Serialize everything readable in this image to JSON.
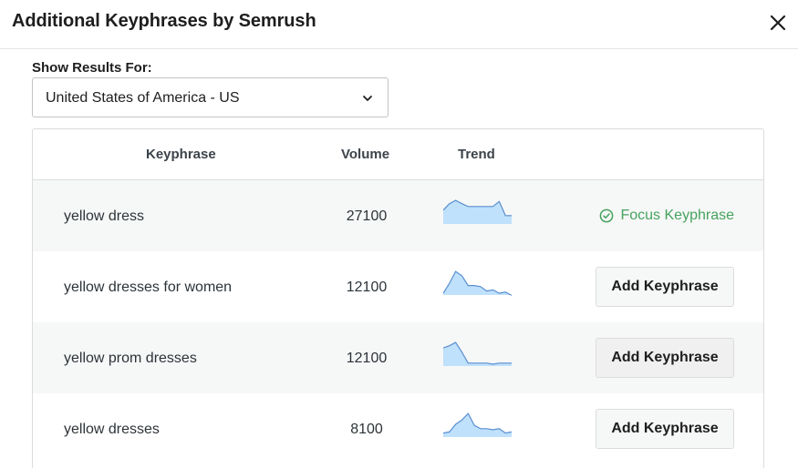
{
  "modal": {
    "title": "Additional Keyphrases by Semrush"
  },
  "filter": {
    "label": "Show Results For:",
    "selected": "United States of America - US"
  },
  "table": {
    "headers": {
      "keyphrase": "Keyphrase",
      "volume": "Volume",
      "trend": "Trend"
    },
    "rows": [
      {
        "keyphrase": "yellow dress",
        "volume": "27100",
        "trend": [
          0.55,
          0.85,
          1.0,
          0.85,
          0.72,
          0.72,
          0.72,
          0.72,
          0.72,
          0.95,
          0.3,
          0.3
        ],
        "status": "Focus Keyphrase"
      },
      {
        "keyphrase": "yellow dresses for women",
        "volume": "12100",
        "trend": [
          0.0,
          0.45,
          1.0,
          0.8,
          0.35,
          0.35,
          0.3,
          0.1,
          0.15,
          0.0,
          0.05,
          -0.1
        ],
        "action": "Add Keyphrase"
      },
      {
        "keyphrase": "yellow prom dresses",
        "volume": "12100",
        "trend": [
          0.75,
          0.85,
          1.0,
          0.55,
          0.05,
          0.05,
          0.05,
          0.05,
          0.0,
          0.05,
          0.05,
          0.05
        ],
        "action": "Add Keyphrase"
      },
      {
        "keyphrase": "yellow dresses",
        "volume": "8100",
        "trend": [
          0.1,
          0.15,
          0.5,
          0.7,
          1.0,
          0.45,
          0.3,
          0.3,
          0.25,
          0.3,
          0.1,
          0.15
        ],
        "action": "Add Keyphrase"
      }
    ]
  },
  "colors": {
    "trend_fill": "#bfe1fb",
    "trend_line": "#5a8fd0",
    "focus": "#46a35e"
  },
  "icons": {
    "close": "close-icon",
    "chevron": "chevron-down-icon",
    "focus": "check-circle-icon"
  }
}
